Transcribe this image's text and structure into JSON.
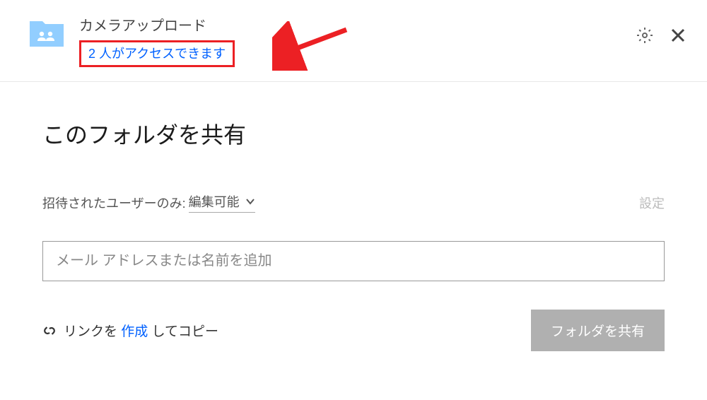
{
  "header": {
    "folder_name": "カメラアップロード",
    "access_text": "2 人がアクセスできます"
  },
  "main": {
    "title": "このフォルダを共有",
    "permission_label": "招待されたユーザーのみ:",
    "permission_value": "編集可能",
    "settings_label": "設定",
    "email_placeholder": "メール アドレスまたは名前を追加",
    "link_prefix": "リンクを",
    "link_create": "作成",
    "link_suffix": "してコピー",
    "share_button": "フォルダを共有"
  },
  "colors": {
    "primary_blue": "#0061ff",
    "folder_blue": "#92ceff",
    "annotation_red": "#ec2024"
  }
}
